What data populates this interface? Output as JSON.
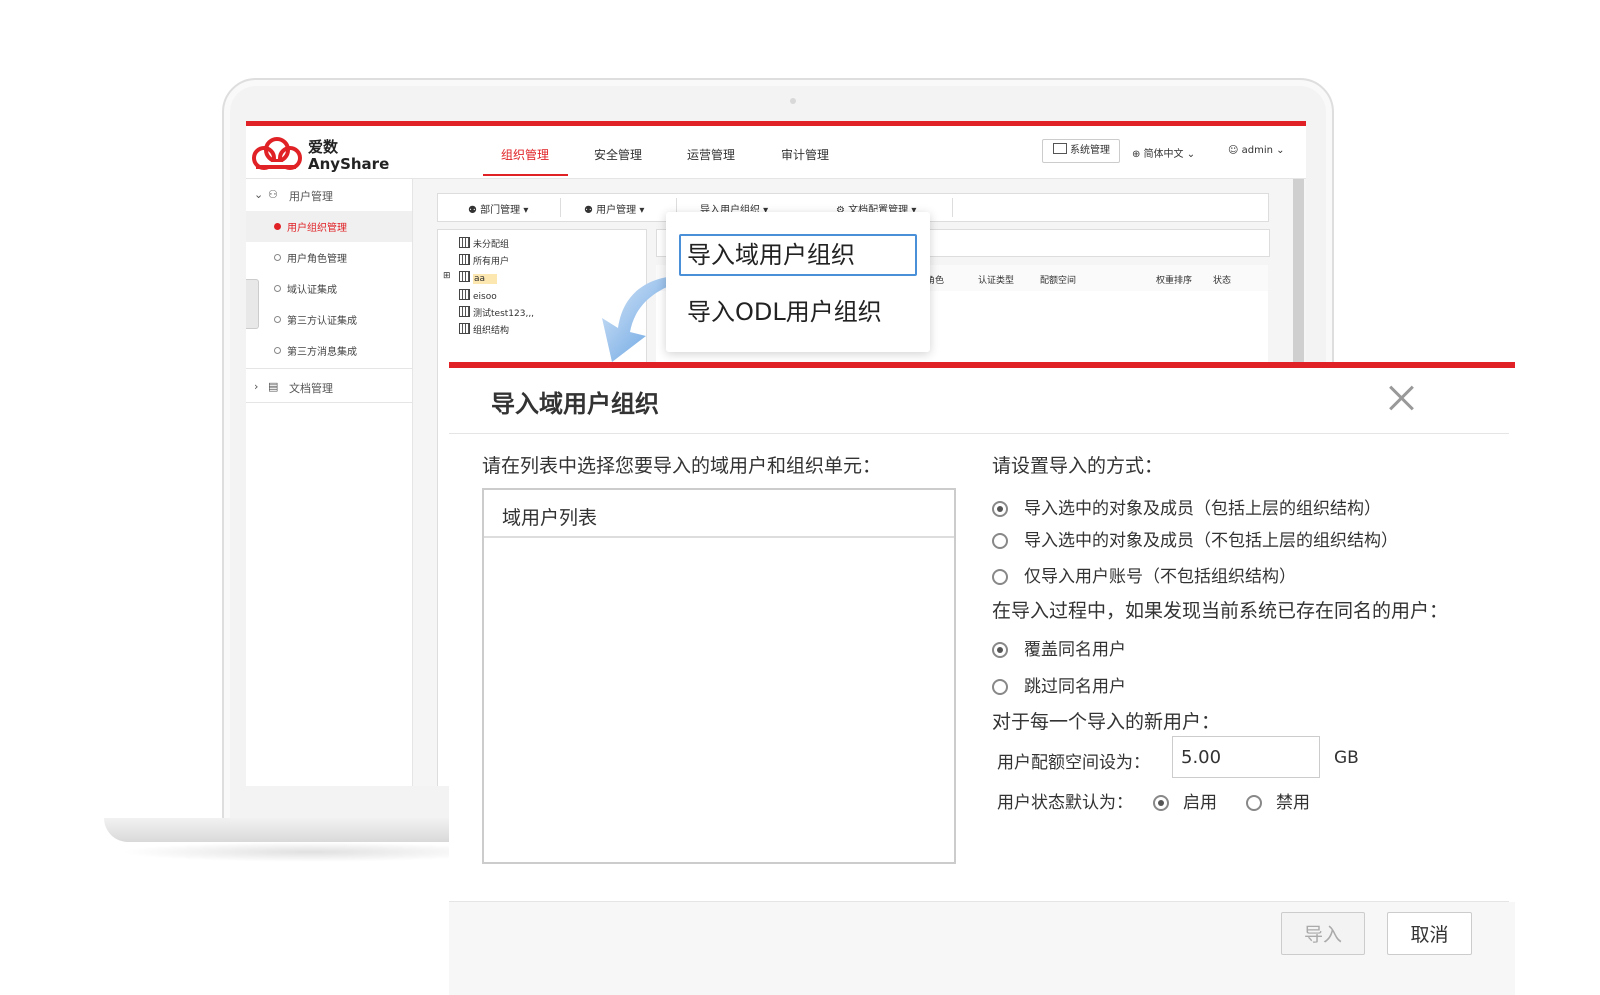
{
  "app": {
    "logo_cn": "爱数",
    "logo_en": "AnyShare",
    "nav": [
      "组织管理",
      "安全管理",
      "运营管理",
      "审计管理"
    ],
    "active_nav": "组织管理",
    "system_button": "系统管理",
    "language": "简体中文",
    "username": "admin",
    "accent_color": "#e02226"
  },
  "sidebar": {
    "group1": "用户管理",
    "items": [
      "用户组织管理",
      "用户角色管理",
      "域认证集成",
      "第三方认证集成",
      "第三方消息集成"
    ],
    "active_item": "用户组织管理",
    "group2": "文档管理"
  },
  "toolbar": {
    "dept_mgmt": "部门管理",
    "user_mgmt": "用户管理",
    "import_org": "导入用户组织",
    "doc_config": "文档配置管理"
  },
  "tree": [
    "未分配组",
    "所有用户",
    "aa",
    "eisoo",
    "测试test123,,,",
    "组织结构"
  ],
  "table_headers": [
    "角色",
    "认证类型",
    "配额空间",
    "权重排序",
    "状态"
  ],
  "dropdown": {
    "item1": "导入域用户组织",
    "item2": "导入ODL用户组织"
  },
  "dialog": {
    "title": "导入域用户组织",
    "left_prompt": "请在列表中选择您要导入的域用户和组织单元：",
    "list_header": "域用户列表",
    "right_prompt": "请设置导入的方式：",
    "import_options": [
      "导入选中的对象及成员（包括上层的组织结构）",
      "导入选中的对象及成员（不包括上层的组织结构）",
      "仅导入用户账号（不包括组织结构）"
    ],
    "conflict_prompt": "在导入过程中，如果发现当前系统已存在同名的用户：",
    "conflict_options": [
      "覆盖同名用户",
      "跳过同名用户"
    ],
    "new_user_prompt": "对于每一个导入的新用户：",
    "quota_label": "用户配额空间设为：",
    "quota_value": "5.00",
    "quota_unit": "GB",
    "status_label": "用户状态默认为：",
    "status_enable": "启用",
    "status_disable": "禁用",
    "import_button": "导入",
    "cancel_button": "取消"
  }
}
